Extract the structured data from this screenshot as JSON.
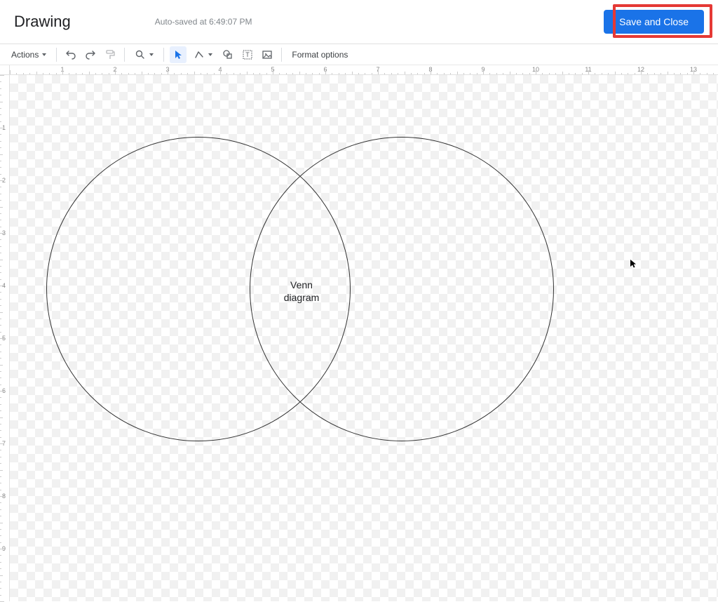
{
  "header": {
    "title": "Drawing",
    "autosave": "Auto-saved at 6:49:07 PM",
    "save_button": "Save and Close"
  },
  "toolbar": {
    "actions_label": "Actions",
    "format_options_label": "Format options"
  },
  "ruler_h": [
    "1",
    "2",
    "3",
    "4",
    "5",
    "6",
    "7",
    "8",
    "9",
    "10",
    "11",
    "12",
    "13"
  ],
  "ruler_v": [
    "1",
    "2",
    "3",
    "4",
    "5",
    "6",
    "7",
    "8",
    "9"
  ],
  "canvas": {
    "text_line1": "Venn",
    "text_line2": "diagram"
  },
  "colors": {
    "primary": "#1a73e8",
    "highlight": "#e53935"
  }
}
